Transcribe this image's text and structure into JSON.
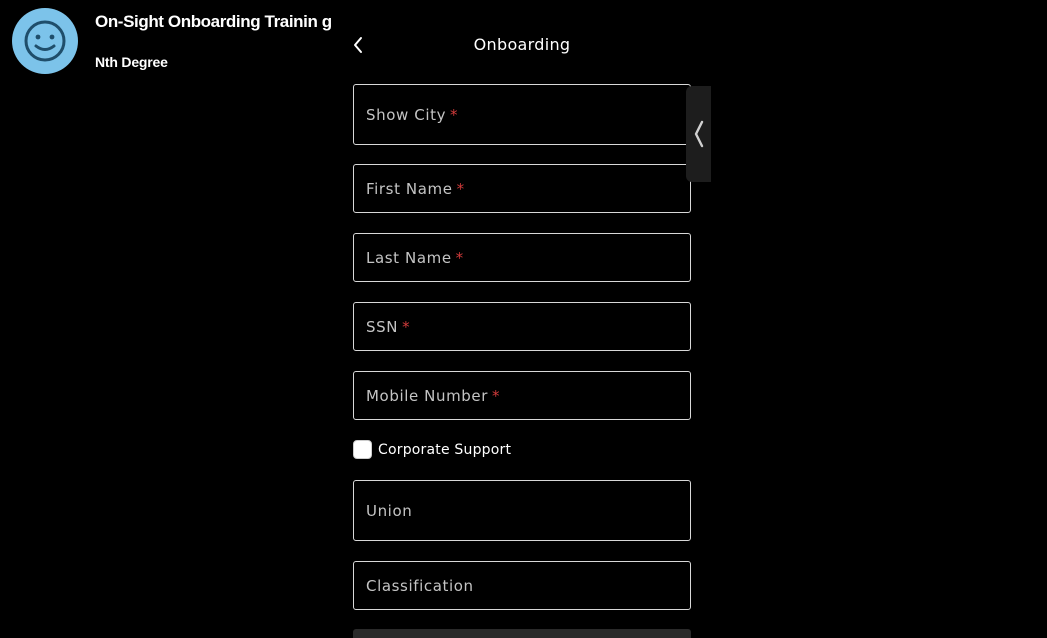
{
  "video": {
    "title": "On-Sight Onboarding Trainin g",
    "channel": "Nth Degree",
    "avatar_icon": "smiley-face-icon",
    "avatar_color": "#7cc3ea"
  },
  "header": {
    "title": "Onboarding",
    "back_icon": "chevron-left-icon"
  },
  "form": {
    "fields": [
      {
        "label": "Show City",
        "required": "*"
      },
      {
        "label": "First Name",
        "required": "*"
      },
      {
        "label": "Last Name",
        "required": "*"
      },
      {
        "label": "SSN",
        "required": "*"
      },
      {
        "label": "Mobile Number",
        "required": "*"
      },
      {
        "label": "Union",
        "required": ""
      },
      {
        "label": "Classification",
        "required": ""
      }
    ],
    "corporate_support": {
      "label": "Corporate Support",
      "checked": false
    }
  },
  "side_tab": {
    "icon": "chevron-left-icon"
  },
  "colors": {
    "background": "#000000",
    "required_marker": "#d23b3b",
    "field_border": "#d8d8d8"
  }
}
